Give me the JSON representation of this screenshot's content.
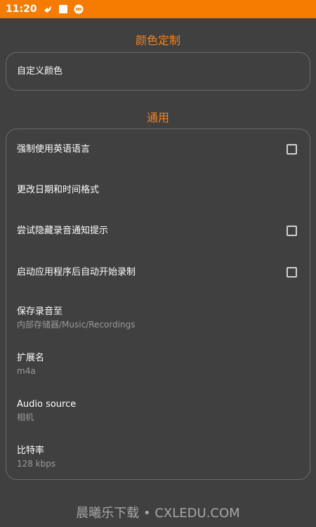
{
  "status_bar": {
    "time": "11:20",
    "icons": [
      "notification-bird-icon",
      "white-square-icon",
      "infinity-badge-icon"
    ],
    "background": "#f57c00"
  },
  "sections": {
    "color_customization": {
      "title": "颜色定制",
      "items": [
        {
          "label": "自定义颜色"
        }
      ]
    },
    "general": {
      "title": "通用",
      "items": [
        {
          "label": "强制使用英语语言",
          "checked": false
        },
        {
          "label": "更改日期和时间格式"
        },
        {
          "label": "尝试隐藏录音通知提示",
          "checked": false
        },
        {
          "label": "启动应用程序后自动开始录制",
          "checked": false
        },
        {
          "label": "保存录音至",
          "value": "内部存储器/Music/Recordings"
        },
        {
          "label": "扩展名",
          "value": "m4a"
        },
        {
          "label": "Audio source",
          "value": "相机"
        },
        {
          "label": "比特率",
          "value": "128 kbps"
        }
      ]
    }
  },
  "watermark": "晨曦乐下载 • CXLEDU.COM",
  "colors": {
    "accent": "#f5821f",
    "background": "#404040",
    "card_border": "#6a6a6a",
    "secondary_text": "#9a9a9a"
  }
}
